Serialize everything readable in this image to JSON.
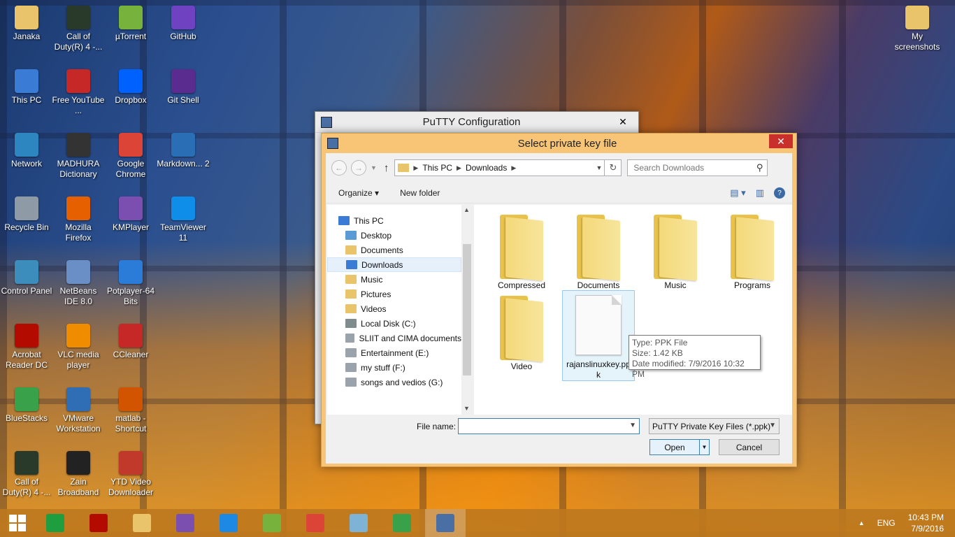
{
  "desktop": {
    "icons": [
      {
        "label": "Janaka",
        "icon": "user-folder-icon",
        "color": "#e9c46a"
      },
      {
        "label": "Call of Duty(R) 4 -...",
        "icon": "cod4-icon",
        "color": "#2a3a2a"
      },
      {
        "label": "µTorrent",
        "icon": "utorrent-icon",
        "color": "#77b33c"
      },
      {
        "label": "GitHub",
        "icon": "github-icon",
        "color": "#6f42c1"
      },
      {
        "label": "This PC",
        "icon": "this-pc-icon",
        "color": "#3a7bd5"
      },
      {
        "label": "Free YouTube ...",
        "icon": "youtube-download-icon",
        "color": "#c62828"
      },
      {
        "label": "Dropbox",
        "icon": "dropbox-icon",
        "color": "#0061fe"
      },
      {
        "label": "Git Shell",
        "icon": "git-shell-icon",
        "color": "#5b2c8f"
      },
      {
        "label": "Network",
        "icon": "network-icon",
        "color": "#2e86c1"
      },
      {
        "label": "MADHURA Dictionary",
        "icon": "dictionary-icon",
        "color": "#333333"
      },
      {
        "label": "Google Chrome",
        "icon": "chrome-icon",
        "color": "#db4437"
      },
      {
        "label": "Markdown... 2",
        "icon": "markdown-icon",
        "color": "#2a6fb5"
      },
      {
        "label": "Recycle Bin",
        "icon": "recycle-bin-icon",
        "color": "#8e9aa6"
      },
      {
        "label": "Mozilla Firefox",
        "icon": "firefox-icon",
        "color": "#e66000"
      },
      {
        "label": "KMPlayer",
        "icon": "kmplayer-icon",
        "color": "#7a4fb0"
      },
      {
        "label": "TeamViewer 11",
        "icon": "teamviewer-icon",
        "color": "#0e8ee9"
      },
      {
        "label": "Control Panel",
        "icon": "control-panel-icon",
        "color": "#3c8dbc"
      },
      {
        "label": "NetBeans IDE 8.0",
        "icon": "netbeans-icon",
        "color": "#6a8fc7"
      },
      {
        "label": "Potplayer-64 Bits",
        "icon": "potplayer-icon",
        "color": "#2b7bd8"
      },
      {
        "label": "Acrobat Reader DC",
        "icon": "acrobat-icon",
        "color": "#b30b00"
      },
      {
        "label": "VLC media player",
        "icon": "vlc-icon",
        "color": "#f08c00"
      },
      {
        "label": "CCleaner",
        "icon": "ccleaner-icon",
        "color": "#c62828"
      },
      {
        "label": "BlueStacks",
        "icon": "bluestacks-icon",
        "color": "#3aa14b"
      },
      {
        "label": "VMware Workstation",
        "icon": "vmware-icon",
        "color": "#2f6db5"
      },
      {
        "label": "matlab - Shortcut",
        "icon": "matlab-icon",
        "color": "#d35400"
      },
      {
        "label": "Call of Duty(R) 4 -...",
        "icon": "cod4-icon",
        "color": "#2a3a2a"
      },
      {
        "label": "Zain Broadband",
        "icon": "zain-icon",
        "color": "#222222"
      },
      {
        "label": "YTD Video Downloader",
        "icon": "ytd-icon",
        "color": "#c0392b"
      },
      {
        "label": "My screenshots",
        "icon": "folder-icon",
        "color": "#e9c46a"
      }
    ]
  },
  "putty": {
    "title": "PuTTY Configuration",
    "close": "✕"
  },
  "dialog": {
    "title": "Select private key file",
    "close": "✕",
    "address": {
      "crumbs": [
        "This PC",
        "Downloads"
      ]
    },
    "search": {
      "placeholder": "Search Downloads"
    },
    "toolbar": {
      "organize": "Organize ▾",
      "new_folder": "New folder"
    },
    "nav_tree": [
      {
        "label": "This PC",
        "icon": "this-pc-icon",
        "color": "#3a7bd5",
        "selected": false
      },
      {
        "label": "Desktop",
        "icon": "desktop-folder-icon",
        "color": "#5b9bd5",
        "selected": false
      },
      {
        "label": "Documents",
        "icon": "documents-folder-icon",
        "color": "#e9c46a",
        "selected": false
      },
      {
        "label": "Downloads",
        "icon": "downloads-folder-icon",
        "color": "#3a7bd5",
        "selected": true
      },
      {
        "label": "Music",
        "icon": "music-folder-icon",
        "color": "#e9c46a",
        "selected": false
      },
      {
        "label": "Pictures",
        "icon": "pictures-folder-icon",
        "color": "#e9c46a",
        "selected": false
      },
      {
        "label": "Videos",
        "icon": "videos-folder-icon",
        "color": "#e9c46a",
        "selected": false
      },
      {
        "label": "Local Disk (C:)",
        "icon": "local-disk-icon",
        "color": "#7f8c8d",
        "selected": false
      },
      {
        "label": "SLIIT and CIMA documents",
        "icon": "drive-icon",
        "color": "#9aa3ab",
        "selected": false
      },
      {
        "label": "Entertainment (E:)",
        "icon": "drive-icon",
        "color": "#9aa3ab",
        "selected": false
      },
      {
        "label": "my stuff (F:)",
        "icon": "drive-icon",
        "color": "#9aa3ab",
        "selected": false
      },
      {
        "label": "songs and vedios (G:)",
        "icon": "drive-icon",
        "color": "#9aa3ab",
        "selected": false
      }
    ],
    "files": [
      {
        "label": "Compressed",
        "type": "folder"
      },
      {
        "label": "Documents",
        "type": "folder"
      },
      {
        "label": "Music",
        "type": "folder"
      },
      {
        "label": "Programs",
        "type": "folder"
      },
      {
        "label": "Video",
        "type": "folder"
      },
      {
        "label": "rajanslinuxkey.ppk",
        "type": "file",
        "selected": true
      }
    ],
    "tooltip": {
      "type": "Type: PPK File",
      "size": "Size: 1.42 KB",
      "modified": "Date modified: 7/9/2016 10:32 PM"
    },
    "file_name_label": "File name:",
    "file_name_value": "",
    "file_type": "PuTTY Private Key Files (*.ppk)",
    "open_label": "Open",
    "cancel_label": "Cancel"
  },
  "taskbar": {
    "apps": [
      {
        "name": "store",
        "icon": "store-icon",
        "color": "#1e9e3e"
      },
      {
        "name": "acrobat",
        "icon": "acrobat-icon",
        "color": "#b30b00"
      },
      {
        "name": "file-explorer",
        "icon": "file-explorer-icon",
        "color": "#e9c46a"
      },
      {
        "name": "kmplayer",
        "icon": "kmplayer-icon",
        "color": "#7a4fb0"
      },
      {
        "name": "internet-explorer",
        "icon": "internet-explorer-icon",
        "color": "#1e88e5"
      },
      {
        "name": "utorrent",
        "icon": "utorrent-icon",
        "color": "#77b33c"
      },
      {
        "name": "chrome",
        "icon": "chrome-icon",
        "color": "#db4437"
      },
      {
        "name": "paint",
        "icon": "paint-icon",
        "color": "#7fb3d5"
      },
      {
        "name": "camtasia",
        "icon": "camtasia-icon",
        "color": "#3aa14b"
      },
      {
        "name": "putty",
        "icon": "putty-icon",
        "color": "#4a6fa5"
      }
    ],
    "language": "ENG",
    "time": "10:43 PM",
    "date": "7/9/2016"
  }
}
